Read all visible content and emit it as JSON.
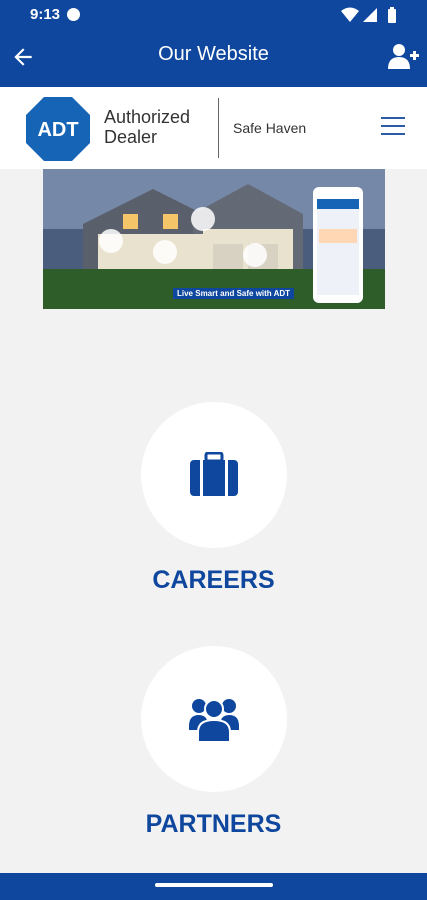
{
  "status_bar": {
    "time": "9:13"
  },
  "app_bar": {
    "title": "Our Website",
    "back_icon": "arrow-left-icon",
    "action_icon": "add-user-icon"
  },
  "site_header": {
    "logo_text": "ADT",
    "brand_line1": "Authorized",
    "brand_line2": "Dealer",
    "dealer_name": "Safe Haven",
    "menu_icon": "hamburger-icon"
  },
  "banner": {
    "caption": "Live Smart and Safe with ADT"
  },
  "links": [
    {
      "label": "CAREERS",
      "icon": "briefcase-icon"
    },
    {
      "label": "PARTNERS",
      "icon": "group-icon"
    }
  ],
  "colors": {
    "primary": "#0e479d",
    "background": "#f2f2f2"
  }
}
